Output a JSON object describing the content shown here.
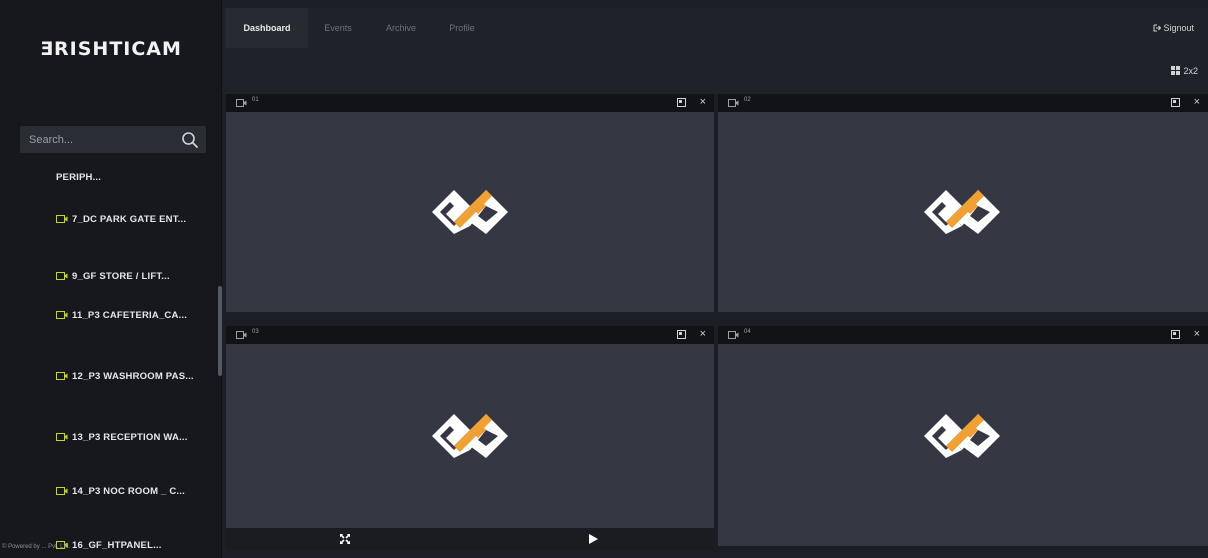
{
  "brand": {
    "logo_text": "ƎRISHTICAM",
    "accent": "#f0a035"
  },
  "search": {
    "placeholder": "Search..."
  },
  "cameras": [
    {
      "label": "PERIPH..."
    },
    {
      "label": "7_DC PARK GATE ENT..."
    },
    {
      "label": "9_GF STORE / LIFT..."
    },
    {
      "label": "11_P3 CAFETERIA_CA..."
    },
    {
      "label": "12_P3 WASHROOM PAS..."
    },
    {
      "label": "13_P3 RECEPTION WA..."
    },
    {
      "label": "14_P3 NOC ROOM _ C..."
    },
    {
      "label": "16_GF_HTPANEL..."
    }
  ],
  "footer": {
    "text": "© Powered by ... Pvt. Ltd."
  },
  "nav": {
    "tabs": [
      "Dashboard",
      "Events",
      "Archive",
      "Profile"
    ],
    "active": "Dashboard",
    "signout": "Signout"
  },
  "layout": {
    "label": "2x2"
  },
  "tiles": [
    {
      "label": "01"
    },
    {
      "label": "02"
    },
    {
      "label": "03"
    },
    {
      "label": "04"
    }
  ]
}
